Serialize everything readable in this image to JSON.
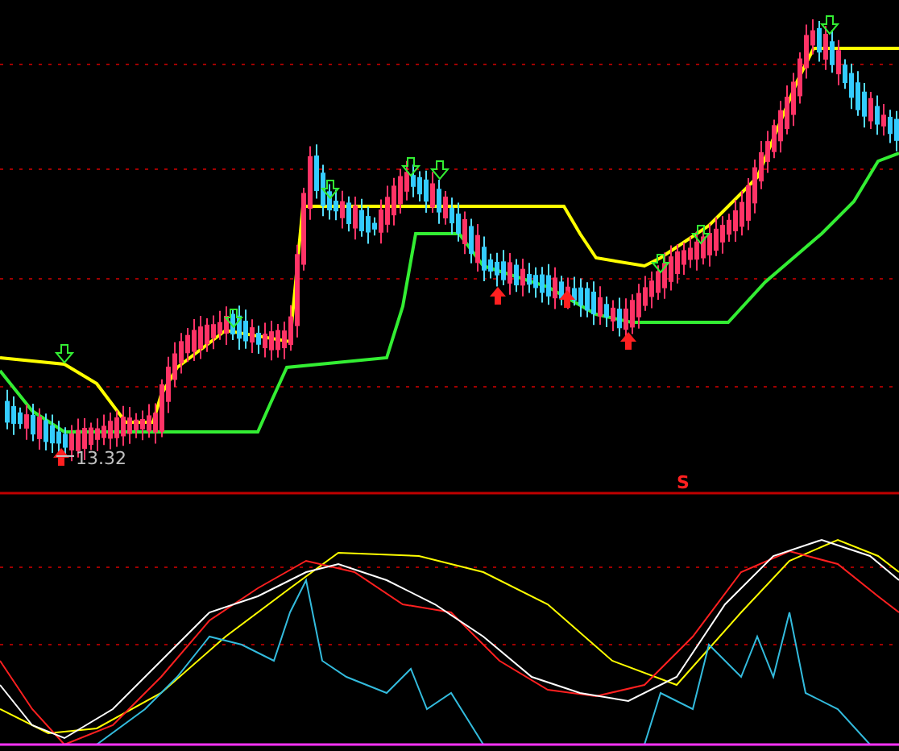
{
  "price_panel": {
    "low_label": "13.32"
  },
  "indicator_panel": {
    "signal_label": "S"
  }
}
